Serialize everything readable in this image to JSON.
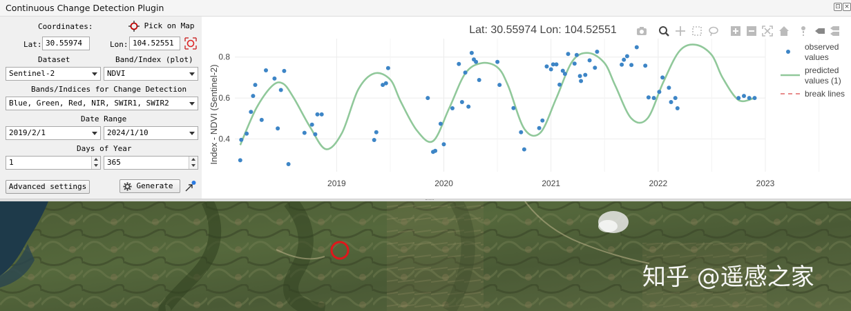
{
  "window": {
    "title": "Continuous Change Detection Plugin"
  },
  "coordinates": {
    "label": "Coordinates:",
    "pick_label": "Pick on Map",
    "lat_label": "Lat:",
    "lat_value": "30.55974",
    "lon_label": "Lon:",
    "lon_value": "104.52551"
  },
  "dataset": {
    "label": "Dataset",
    "value": "Sentinel-2"
  },
  "band": {
    "label": "Band/Index (plot)",
    "value": "NDVI"
  },
  "bands_detect": {
    "label": "Bands/Indices for Change Detection",
    "value": "Blue, Green, Red, NIR, SWIR1, SWIR2"
  },
  "date_range": {
    "label": "Date Range",
    "start": "2019/2/1",
    "end": "2024/1/10"
  },
  "days_of_year": {
    "label": "Days of Year",
    "start": "1",
    "end": "365"
  },
  "buttons": {
    "advanced": "Advanced settings",
    "generate": "Generate"
  },
  "chart_data": {
    "type": "scatter",
    "title": "Lat: 30.55974 Lon: 104.52551",
    "ylabel": "Index - NDVI (Sentinel-2)",
    "xlabel": "",
    "x_ticks": [
      "2019",
      "2020",
      "2021",
      "2022",
      "2023"
    ],
    "y_ticks": [
      "0.4",
      "0.6",
      "0.8"
    ],
    "xlim": [
      2018.55,
      2023.5
    ],
    "ylim": [
      0.24,
      0.89
    ],
    "legend": {
      "placement": "right",
      "entries": [
        "observed values",
        "predicted values (1)",
        "break lines"
      ]
    },
    "observed": {
      "x": [
        2018.6,
        2018.61,
        2018.66,
        2018.7,
        2018.72,
        2018.74,
        2018.8,
        2018.84,
        2018.92,
        2018.95,
        2018.98,
        2019.01,
        2019.05,
        2019.2,
        2019.27,
        2019.3,
        2019.32,
        2019.36,
        2019.85,
        2019.87,
        2019.93,
        2019.96,
        2019.98,
        2020.35,
        2020.4,
        2020.42,
        2020.47,
        2020.5,
        2020.58,
        2020.64,
        2020.67,
        2020.7,
        2020.73,
        2020.76,
        2020.78,
        2020.8,
        2020.83,
        2021.0,
        2021.02,
        2021.15,
        2021.22,
        2021.25,
        2021.39,
        2021.42,
        2021.46,
        2021.5,
        2021.52,
        2021.55,
        2021.58,
        2021.61,
        2021.63,
        2021.66,
        2021.72,
        2021.74,
        2021.77,
        2021.78,
        2021.82,
        2021.86,
        2021.91,
        2021.93,
        2022.16,
        2022.18,
        2022.21,
        2022.25,
        2022.3,
        2022.38,
        2022.41,
        2022.46,
        2022.51,
        2022.54,
        2022.6,
        2022.62,
        2022.66,
        2022.68,
        2023.25,
        2023.3,
        2023.35,
        2023.4
      ],
      "y": [
        0.296,
        0.396,
        0.426,
        0.532,
        0.61,
        0.664,
        0.493,
        0.735,
        0.695,
        0.451,
        0.639,
        0.732,
        0.277,
        0.43,
        0.47,
        0.423,
        0.52,
        0.52,
        0.395,
        0.433,
        0.664,
        0.672,
        0.746,
        0.6,
        0.337,
        0.342,
        0.474,
        0.374,
        0.55,
        0.766,
        0.58,
        0.724,
        0.558,
        0.82,
        0.788,
        0.776,
        0.688,
        0.776,
        0.664,
        0.551,
        0.433,
        0.349,
        0.453,
        0.49,
        0.754,
        0.74,
        0.764,
        0.764,
        0.665,
        0.733,
        0.718,
        0.815,
        0.768,
        0.81,
        0.707,
        0.683,
        0.713,
        0.784,
        0.748,
        0.826,
        0.763,
        0.787,
        0.804,
        0.761,
        0.848,
        0.758,
        0.603,
        0.6,
        0.63,
        0.7,
        0.65,
        0.58,
        0.6,
        0.55,
        0.6,
        0.61,
        0.6,
        0.6
      ]
    },
    "predicted": {
      "x": [
        2018.6,
        2018.75,
        2018.9,
        2019.0,
        2019.1,
        2019.25,
        2019.4,
        2019.55,
        2019.7,
        2019.85,
        2020.0,
        2020.1,
        2020.25,
        2020.4,
        2020.55,
        2020.7,
        2020.85,
        2021.0,
        2021.1,
        2021.25,
        2021.4,
        2021.55,
        2021.7,
        2021.85,
        2022.0,
        2022.1,
        2022.25,
        2022.4,
        2022.55,
        2022.7,
        2022.85,
        2023.0,
        2023.1,
        2023.25,
        2023.4
      ],
      "y": [
        0.37,
        0.55,
        0.66,
        0.67,
        0.6,
        0.46,
        0.35,
        0.43,
        0.64,
        0.72,
        0.69,
        0.58,
        0.44,
        0.39,
        0.55,
        0.72,
        0.77,
        0.75,
        0.66,
        0.45,
        0.43,
        0.6,
        0.78,
        0.82,
        0.77,
        0.66,
        0.5,
        0.5,
        0.68,
        0.83,
        0.86,
        0.81,
        0.7,
        0.59,
        0.6
      ]
    }
  },
  "map": {
    "watermark": "知乎 @遥感之家"
  }
}
